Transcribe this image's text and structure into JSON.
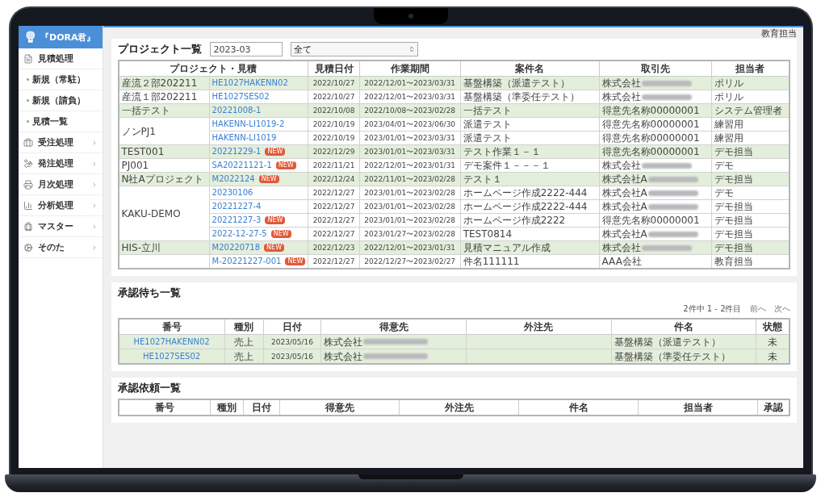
{
  "logo": {
    "text": "『DORA君』"
  },
  "user": {
    "name": "教育担当"
  },
  "sidebar": {
    "items": [
      {
        "label": "見積処理",
        "expanded": true,
        "children": [
          {
            "label": "新規（常駐）"
          },
          {
            "label": "新規（請負）"
          },
          {
            "label": "見積一覧"
          }
        ]
      },
      {
        "label": "受注処理",
        "expanded": false
      },
      {
        "label": "発注処理",
        "expanded": false
      },
      {
        "label": "月次処理",
        "expanded": false
      },
      {
        "label": "分析処理",
        "expanded": false
      },
      {
        "label": "マスター",
        "expanded": false
      },
      {
        "label": "そのた",
        "expanded": false
      }
    ]
  },
  "project_list": {
    "title": "プロジェクト一覧",
    "month_field": {
      "value": "2023-03"
    },
    "status_select": {
      "value": "全て"
    },
    "columns": [
      "プロジェクト・見積",
      "見積日付",
      "作業期間",
      "案件名",
      "取引先",
      "担当者"
    ],
    "projects": [
      {
        "name": "産流２部202211",
        "estimates": [
          {
            "number": "HE1027HAKENN02",
            "date": "2022/10/27",
            "period": "2022/12/01〜2023/03/31",
            "title": "基盤構築（派遣テスト）",
            "client": {
              "text": "株式会社",
              "redacted": true
            },
            "person": "ポリル"
          }
        ]
      },
      {
        "name": "産流１部202211",
        "estimates": [
          {
            "number": "HE1027SES02",
            "date": "2022/10/27",
            "period": "2022/12/01〜2023/03/31",
            "title": "基盤構築（準委任テスト）",
            "client": {
              "text": "株式会社",
              "redacted": true
            },
            "person": "ポリル"
          }
        ]
      },
      {
        "name": "一括テスト",
        "estimates": [
          {
            "number": "20221008-1",
            "date": "2022/10/08",
            "period": "2022/10/08〜2023/02/28",
            "title": "一括テスト",
            "client": {
              "text": "得意先名称00000001",
              "redacted": false
            },
            "person": "システム管理者"
          }
        ]
      },
      {
        "name": "ノンPJ1",
        "estimates": [
          {
            "number": "HAKENN-LI1019-2",
            "date": "2022/10/19",
            "period": "2023/04/01〜2023/06/30",
            "title": "派遣テスト",
            "client": {
              "text": "得意先名称00000001",
              "redacted": false
            },
            "person": "練習用"
          },
          {
            "number": "HAKENN-LI1019",
            "date": "2022/10/19",
            "period": "2023/01/01〜2023/03/31",
            "title": "派遣テスト",
            "client": {
              "text": "得意先名称00000001",
              "redacted": false
            },
            "person": "練習用"
          }
        ]
      },
      {
        "name": "TEST001",
        "estimates": [
          {
            "number": "20221229-1",
            "badge": "NEW",
            "date": "2022/12/29",
            "period": "2023/01/01〜2023/03/31",
            "title": "テスト作業１－１",
            "client": {
              "text": "得意先名称00000001",
              "redacted": false
            },
            "person": "デモ担当"
          }
        ]
      },
      {
        "name": "PJ001",
        "estimates": [
          {
            "number": "SA20221121-1",
            "badge": "NEW",
            "date": "2022/11/21",
            "period": "2022/12/01〜2023/01/31",
            "title": "デモ案件１－－－１",
            "client": {
              "text": "株式会社",
              "redacted": true
            },
            "person": "デモ"
          }
        ]
      },
      {
        "name": "N社Aプロジェクト",
        "estimates": [
          {
            "number": "M2022124",
            "badge": "NEW",
            "date": "2022/12/24",
            "period": "2022/11/01〜2023/02/28",
            "title": "テスト１",
            "client": {
              "text": "株式会社A",
              "redacted": true
            },
            "person": "デモ担当"
          }
        ]
      },
      {
        "name": "KAKU-DEMO",
        "estimates": [
          {
            "number": "20230106",
            "date": "2022/12/27",
            "period": "2023/01/01〜2023/02/28",
            "title": "ホームページ作成2222-444",
            "client": {
              "text": "株式会社A",
              "redacted": true
            },
            "person": "デモ"
          },
          {
            "number": "20221227-4",
            "date": "2022/12/27",
            "period": "2023/01/01〜2023/02/28",
            "title": "ホームページ作成2222-444",
            "client": {
              "text": "株式会社A",
              "redacted": true
            },
            "person": "デモ担当"
          },
          {
            "number": "20221227-3",
            "badge": "NEW",
            "date": "2022/12/27",
            "period": "2023/01/01〜2023/02/28",
            "title": "ホームページ作成2222",
            "client": {
              "text": "得意先名称00000001",
              "redacted": false
            },
            "person": "デモ担当"
          },
          {
            "number": "2022-12-27-5",
            "badge": "NEW",
            "date": "2022/12/27",
            "period": "2023/01/27〜2023/02/28",
            "title": "TEST0814",
            "client": {
              "text": "株式会社A",
              "redacted": true
            },
            "person": "デモ担当"
          }
        ]
      },
      {
        "name": "HIS-立川",
        "estimates": [
          {
            "number": "M20220718",
            "badge": "NEW",
            "date": "2022/12/23",
            "period": "2022/12/01〜2023/01/31",
            "title": "見積マニュアル作成",
            "client": {
              "text": "株式会社",
              "redacted": true
            },
            "person": "デモ担当"
          }
        ]
      },
      {
        "estimates": [
          {
            "number": "M-20221227-001",
            "badge": "NEW",
            "date": "2022/12/27",
            "period": "2022/12/27〜2023/02/27",
            "title": "件名111111",
            "client": {
              "text": "AAA会社",
              "redacted": false
            },
            "person": "教育担当"
          }
        ]
      }
    ]
  },
  "pending_approvals": {
    "title": "承認待ち一覧",
    "count": "2件中 1 - 2件目",
    "prev": "前へ",
    "next": "次へ",
    "columns": [
      "番号",
      "種別",
      "日付",
      "得意先",
      "外注先",
      "件名",
      "状態"
    ],
    "rows": [
      {
        "number": "HE1027HAKENN02",
        "type": "売上",
        "date": "2023/05/16",
        "customer": {
          "text": "株式会社",
          "redacted": true
        },
        "title": "基盤構築（派遣テスト）",
        "status": "未"
      },
      {
        "number": "HE1027SES02",
        "type": "売上",
        "date": "2023/05/16",
        "customer": {
          "text": "株式会社",
          "redacted": true
        },
        "title": "基盤構築（準委任テスト）",
        "status": "未"
      }
    ]
  },
  "approval_requests": {
    "title": "承認依頼一覧",
    "columns": [
      "番号",
      "種別",
      "日付",
      "得意先",
      "外注先",
      "件名",
      "担当者",
      "承認"
    ]
  }
}
